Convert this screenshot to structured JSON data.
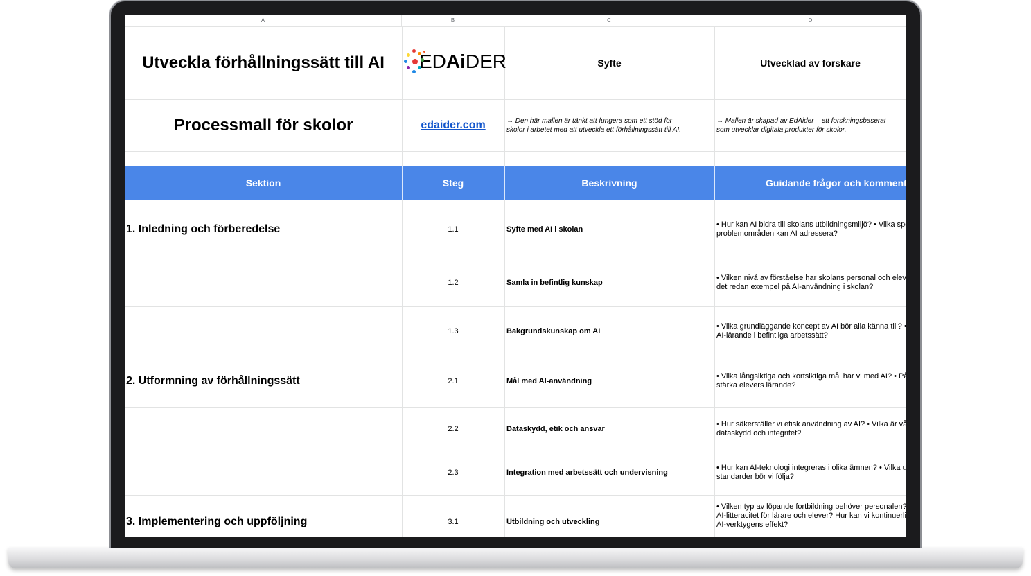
{
  "columns": [
    "A",
    "B",
    "C",
    "D"
  ],
  "top": {
    "title": "Utveckla förhållningssätt till AI",
    "subtitle": "Processmall för skolor",
    "logo_text_pre": "ED",
    "logo_text_ai": "Ai",
    "logo_text_post": "DER",
    "link": "edaider.com",
    "purpose_header": "Syfte",
    "developed_header": "Utvecklad av forskare",
    "purpose_note_1": "→   Den här mallen är tänkt att fungera som ett stöd för",
    "purpose_note_2": "skolor i arbetet med att utveckla ett förhållningssätt till AI.",
    "developed_note_1": "→   Mallen är skapad av EdAider – ett forskningsbaserat",
    "developed_note_2": "som utvecklar digitala produkter för skolor."
  },
  "table": {
    "headers": [
      "Sektion",
      "Steg",
      "Beskrivning",
      "Guidande frågor och kommentarer"
    ],
    "rows": [
      {
        "section": "1. Inledning och förberedelse",
        "num": "1.1",
        "step": "Syfte med AI i skolan",
        "guide1": "• Hur kan AI bidra till skolans utbildningsmiljö? • Vilka specifika",
        "guide2": "problemområden kan AI adressera?",
        "guide3": ""
      },
      {
        "section": "",
        "num": "1.2",
        "step": "Samla in befintlig kunskap",
        "guide1": "• Vilken nivå av förståelse har skolans personal och elever? Finns",
        "guide2": "det redan exempel på AI-användning i skolan?",
        "guide3": ""
      },
      {
        "section": "",
        "num": "1.3",
        "step": "Bakgrundskunskap om AI",
        "guide1": "• Vilka grundläggande koncept av AI bör alla känna till? • Hur passar",
        "guide2": "AI-lärande i befintliga arbetssätt?",
        "guide3": ""
      },
      {
        "section": "2. Utformning av förhållningssätt",
        "num": "2.1",
        "step": "Mål med AI-användning",
        "guide1": "• Vilka långsiktiga och kortsiktiga mål har vi med AI? • På vilka sätt kan AI",
        "guide2": "stärka elevers lärande?",
        "guide3": ""
      },
      {
        "section": "",
        "num": "2.2",
        "step": "Dataskydd, etik och ansvar",
        "guide1": "• Hur säkerställer vi etisk användning av AI? • Vilka är våra riktlinjer för",
        "guide2": "dataskydd och integritet?",
        "guide3": ""
      },
      {
        "section": "",
        "num": "2.3",
        "step": "Integration med arbetssätt och undervisning",
        "guide1": "• Hur kan AI-teknologi integreras i olika ämnen? • Vilka utbildnings-",
        "guide2": "standarder bör vi följa?",
        "guide3": ""
      },
      {
        "section": "3. Implementering och uppföljning",
        "num": "3.1",
        "step": "Utbildning och utveckling",
        "guide1": "• Vilken typ av löpande fortbildning behöver personalen? • Hur ökar vi",
        "guide2": "AI-litteracitet för lärare och elever? Hur kan vi kontinuerligt utvärdera",
        "guide3": "AI-verktygens effekt?"
      }
    ]
  },
  "colors": {
    "header_blue": "#4a86e8",
    "link_blue": "#1155cc",
    "grid": "#e2e3e3",
    "bezel": "#1b1b1d"
  },
  "logo_dot_colors": [
    "#e53935",
    "#fb8c00",
    "#fdd835",
    "#43a047",
    "#1e88e5",
    "#8e24aa",
    "#00acc1",
    "#f4511e"
  ]
}
